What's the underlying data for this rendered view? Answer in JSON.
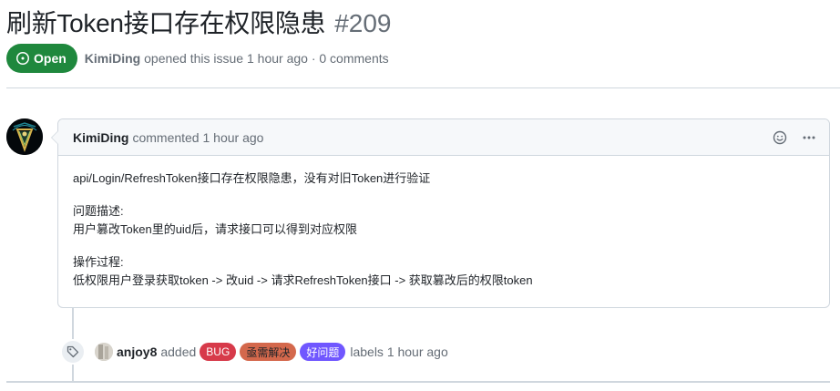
{
  "issue": {
    "title": "刷新Token接口存在权限隐患",
    "number": "#209",
    "state_label": "Open",
    "author": "KimiDing",
    "opened_text": "opened this issue 1 hour ago · 0 comments"
  },
  "comment": {
    "author": "KimiDing",
    "meta": "commented 1 hour ago",
    "body": {
      "line1": "api/Login/RefreshToken接口存在权限隐患，没有对旧Token进行验证",
      "section1_title": "问题描述:",
      "section1_text": "用户篡改Token里的uid后，请求接口可以得到对应权限",
      "section2_title": "操作过程:",
      "section2_text": "低权限用户登录获取token -> 改uid -> 请求RefreshToken接口 -> 获取篡改后的权限token"
    }
  },
  "event": {
    "actor": "anjoy8",
    "verb": "added",
    "labels": [
      {
        "name": "BUG",
        "bg": "#d73a4a",
        "fg": "#ffffff"
      },
      {
        "name": "亟需解决",
        "bg": "#d4684c",
        "fg": "#1f2328"
      },
      {
        "name": "好问题",
        "bg": "#7057ff",
        "fg": "#ffffff"
      }
    ],
    "suffix": "labels 1 hour ago"
  },
  "icons": {
    "state": "issue-open-icon",
    "reaction": "smiley-icon",
    "menu": "kebab-horizontal-icon",
    "event": "tag-icon"
  },
  "colors": {
    "open_green": "#1f883d",
    "border": "#d0d7de",
    "muted": "#656d76"
  }
}
